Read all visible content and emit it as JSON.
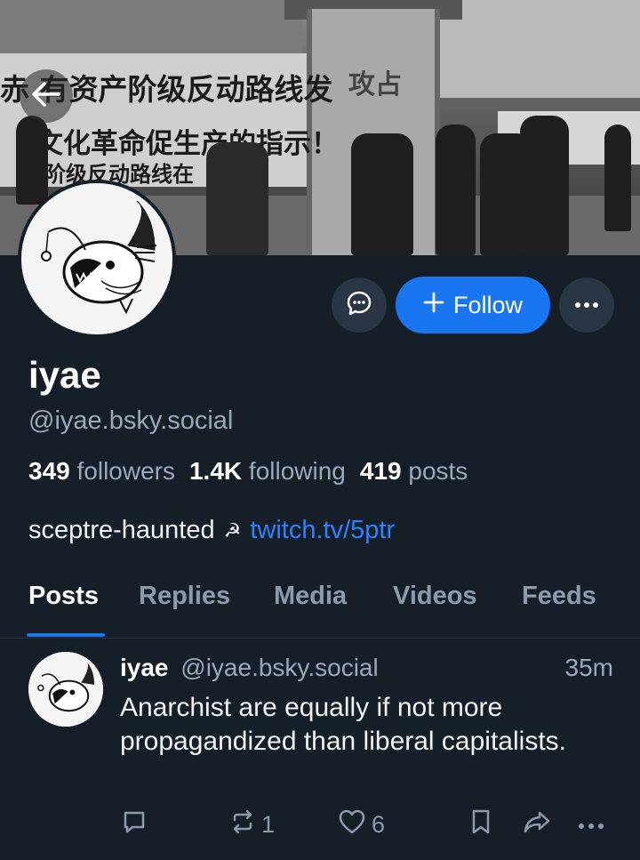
{
  "header": {
    "back_icon": "arrow-left-icon"
  },
  "banner": {
    "texts": [
      "赤 有资产阶级反动路线发",
      "文化革命促生产的指示！",
      "阶级反动路线在",
      "攻占"
    ]
  },
  "profile": {
    "display_name": "iyae",
    "handle": "@iyae.bsky.social",
    "followers_count": "349",
    "followers_label": "followers",
    "following_count": "1.4K",
    "following_label": "following",
    "posts_count": "419",
    "posts_label": "posts",
    "bio_text": "sceptre-haunted",
    "bio_symbol": "☭",
    "bio_link": "twitch.tv/5ptr"
  },
  "actions": {
    "message_icon": "chat-bubble-icon",
    "follow_label": "Follow",
    "more_icon": "ellipsis-icon"
  },
  "tabs": [
    {
      "label": "Posts",
      "active": true
    },
    {
      "label": "Replies",
      "active": false
    },
    {
      "label": "Media",
      "active": false
    },
    {
      "label": "Videos",
      "active": false
    },
    {
      "label": "Feeds",
      "active": false
    }
  ],
  "post": {
    "author_name": "iyae",
    "author_handle": "@iyae.bsky.social",
    "time": "35m",
    "text": "Anarchist are equally if not more propagandized than liberal capitalists.",
    "reply_count": "",
    "repost_count": "1",
    "like_count": "6"
  },
  "colors": {
    "background": "#161e27",
    "accent": "#1a75f0",
    "muted": "#9aa8b8"
  }
}
